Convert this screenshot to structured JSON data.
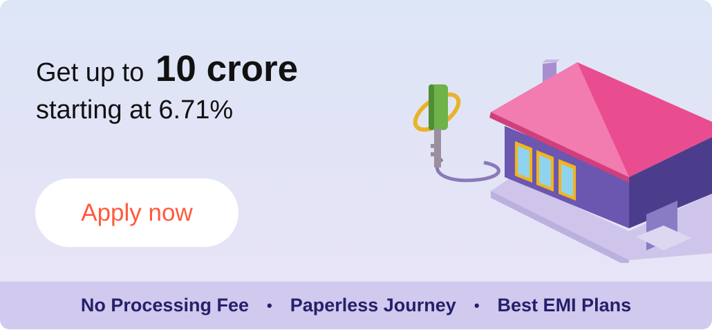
{
  "banner": {
    "headline_prefix": "Get up to",
    "headline_amount": "10 crore",
    "headline_rate": "starting at 6.71%",
    "cta_label": "Apply now",
    "features": [
      "No Processing Fee",
      "Paperless Journey",
      "Best EMI Plans"
    ],
    "separator": "•"
  },
  "colors": {
    "cta_text": "#ff5a3c",
    "footer_bg": "#d1c9ee",
    "footer_text": "#26206a",
    "roof": "#f0609b",
    "walls": "#6b57b0",
    "key": "#6fb24a"
  },
  "illustration": {
    "icon": "house-with-key-icon"
  }
}
